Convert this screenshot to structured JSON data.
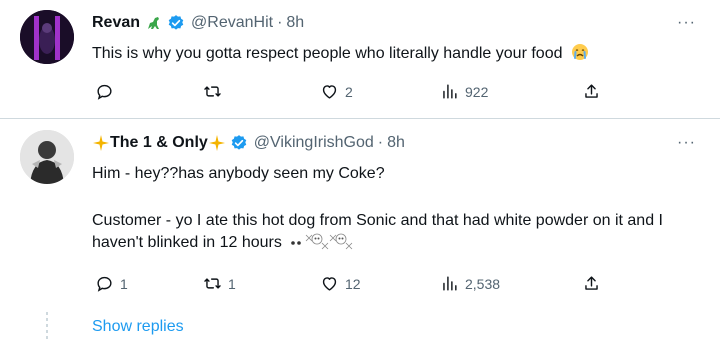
{
  "colors": {
    "accent": "#1d9bf0",
    "text": "#0f1419",
    "muted": "#536471",
    "divider": "#cfd9de"
  },
  "tweets": [
    {
      "display_name": "Revan",
      "name_emoji": "dinosaur-emoji",
      "verified": true,
      "handle": "@RevanHit",
      "dot": "·",
      "time": "8h",
      "text": "This is why you gotta respect people who literally handle your food",
      "text_emoji": "crying-face-emoji",
      "actions": {
        "reply": "",
        "retweet": "",
        "like": "2",
        "views": "922"
      }
    },
    {
      "display_name": "The 1 & Only",
      "name_emoji": "sparkles-emoji",
      "verified": true,
      "handle": "@VikingIrishGod",
      "dot": "·",
      "time": "8h",
      "text_line1": "Him - hey??has anybody seen my Coke?",
      "text_line2": "Customer - yo I ate this hot dog from Sonic and that had white powder on it and I haven't blinked in 12 hours",
      "text_emoji": "eyes-skull-emoji",
      "actions": {
        "reply": "1",
        "retweet": "1",
        "like": "12",
        "views": "2,538"
      }
    }
  ],
  "show_replies": "Show replies",
  "more_glyph": "···"
}
